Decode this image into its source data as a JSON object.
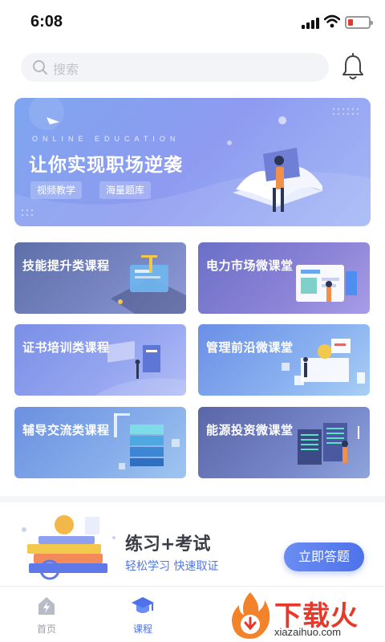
{
  "status_bar": {
    "time": "6:08"
  },
  "search": {
    "placeholder": "搜索"
  },
  "banner": {
    "subtitle": "ONLINE EDUCATION",
    "title": "让你实现职场逆袭",
    "tags": [
      "视频教学",
      "海量题库"
    ]
  },
  "courses": [
    {
      "title": "技能提升类课程"
    },
    {
      "title": "电力市场微课堂"
    },
    {
      "title": "证书培训类课程"
    },
    {
      "title": "管理前沿微课堂"
    },
    {
      "title": "辅导交流类课程"
    },
    {
      "title": "能源投资微课堂"
    }
  ],
  "promo": {
    "title": "练习+考试",
    "subtitle": "轻松学习  快速取证",
    "button": "立即答题"
  },
  "tabbar": {
    "items": [
      {
        "label": "首页",
        "active": false
      },
      {
        "label": "课程",
        "active": true
      }
    ]
  },
  "watermark": {
    "text": "下载火",
    "url": "xiazaihuo.com"
  },
  "colors": {
    "accent": "#4e72ea",
    "tab_active": "#4e72ea",
    "tab_inactive": "#9a9ea8",
    "watermark": "#e6392b"
  },
  "icons": [
    "search-icon",
    "bell-icon",
    "home-icon",
    "graduation-cap-icon",
    "fire-logo-icon"
  ]
}
